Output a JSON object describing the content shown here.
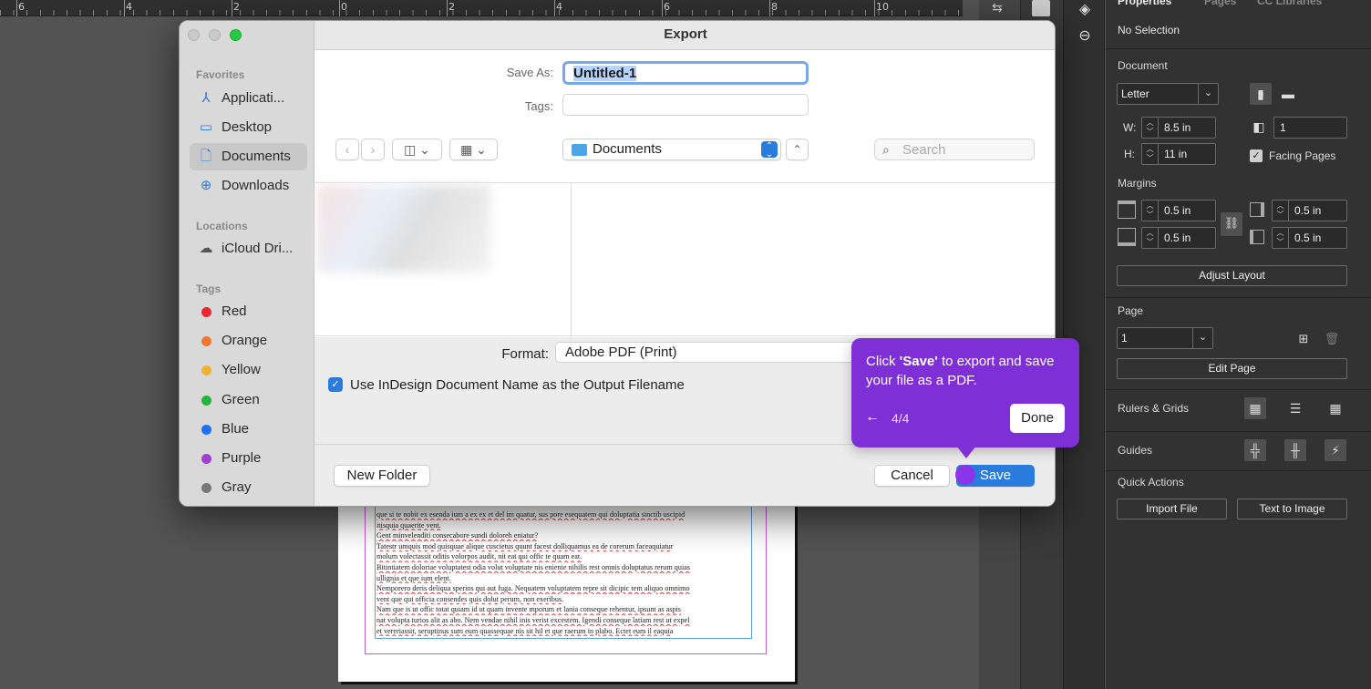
{
  "ruler": {
    "labels": [
      "6",
      "4",
      "2",
      "0",
      "2",
      "4",
      "6",
      "8",
      "10"
    ]
  },
  "document_text": [
    "que si te nobit ex esenda ium a ex ex et del im quatur, sus pore esequatem qui doluptatia sinctib uscipid",
    "itisquia quaerite vent.",
    "Gent minvelenditi consecabore sundi doloreh eniatur?",
    "Tatestr umquis mod quisquae alique cuscietus quunt facest dolliquamus ea de corerum faceaquiatur",
    "molum volectassit oditis volorpos audit, nit eat qui offic te quam eat.",
    "Bitintiatem doloriae voluptatest odia volut voluptate nis enienie nihilis rest omnis doluptatus rerum quias",
    "ullignia et que ium elent.",
    "Nemporero deris deliqua sperios qui aut fuga. Nequatem voluptatem repre sit dicipic tem aliquo omnimo",
    "vent que qui officia consendes quis dolut perum, non exeribus.",
    "Nam que is ut offic totat quiam id ut quam invente mporum et lania conseque rehentur, ipsunt as aspis",
    "nat volupta turios alit as abo. Nem vendae nihil inis verist excestem. Igendi conseque latiam rest ut expel",
    "et vereriassit, seruptinus sum eum quassequae nis sit hil et que raerum in plabo. Ectet eum il eaquia"
  ],
  "properties": {
    "top_tabs": [
      "Properties",
      "Pages",
      "CC Libraries"
    ],
    "no_selection": "No Selection",
    "document_title": "Document",
    "page_size": "Letter",
    "width_label": "W:",
    "width_value": "8.5 in",
    "height_label": "H:",
    "height_value": "11 in",
    "pages_value": "1",
    "facing_pages_label": "Facing Pages",
    "facing_pages_checked": true,
    "margins_title": "Margins",
    "margin_top": "0.5 in",
    "margin_bottom": "0.5 in",
    "margin_inside": "0.5 in",
    "margin_outside": "0.5 in",
    "adjust_layout": "Adjust Layout",
    "page_title": "Page",
    "page_value": "1",
    "edit_page": "Edit Page",
    "rulers_grids": "Rulers & Grids",
    "guides": "Guides",
    "quick_actions": "Quick Actions",
    "import_file": "Import File",
    "text_to_image": "Text to Image"
  },
  "dialog": {
    "title": "Export",
    "sidebar": {
      "favorites_header": "Favorites",
      "favorites": [
        {
          "label": "Applicati...",
          "icon": "applications-icon"
        },
        {
          "label": "Desktop",
          "icon": "desktop-icon"
        },
        {
          "label": "Documents",
          "icon": "document-icon",
          "selected": true
        },
        {
          "label": "Downloads",
          "icon": "downloads-icon"
        }
      ],
      "locations_header": "Locations",
      "locations": [
        {
          "label": "iCloud Dri...",
          "icon": "cloud-icon"
        }
      ],
      "tags_header": "Tags",
      "tags": [
        {
          "label": "Red",
          "color": "#f0262f"
        },
        {
          "label": "Orange",
          "color": "#f2772b"
        },
        {
          "label": "Yellow",
          "color": "#f4b12a"
        },
        {
          "label": "Green",
          "color": "#27b43d"
        },
        {
          "label": "Blue",
          "color": "#1f6ff0"
        },
        {
          "label": "Purple",
          "color": "#a03fd0"
        },
        {
          "label": "Gray",
          "color": "#777777"
        }
      ]
    },
    "save_as_label": "Save As:",
    "save_as_value": "Untitled-1",
    "tags_label": "Tags:",
    "location": "Documents",
    "search_placeholder": "Search",
    "format_label": "Format:",
    "format_value": "Adobe PDF (Print)",
    "use_indesign_name_label": "Use InDesign Document Name as the Output Filename",
    "use_indesign_name_checked": true,
    "new_folder": "New Folder",
    "cancel": "Cancel",
    "save": "Save"
  },
  "tooltip": {
    "message_prefix": "Click ",
    "message_bold": "'Save'",
    "message_suffix": " to export and save your file as a PDF.",
    "step": "4/4",
    "done": "Done",
    "accent": "#7e2fd6"
  },
  "colors": {
    "accent_blue": "#2a7bde",
    "panel_dark": "#323232"
  }
}
